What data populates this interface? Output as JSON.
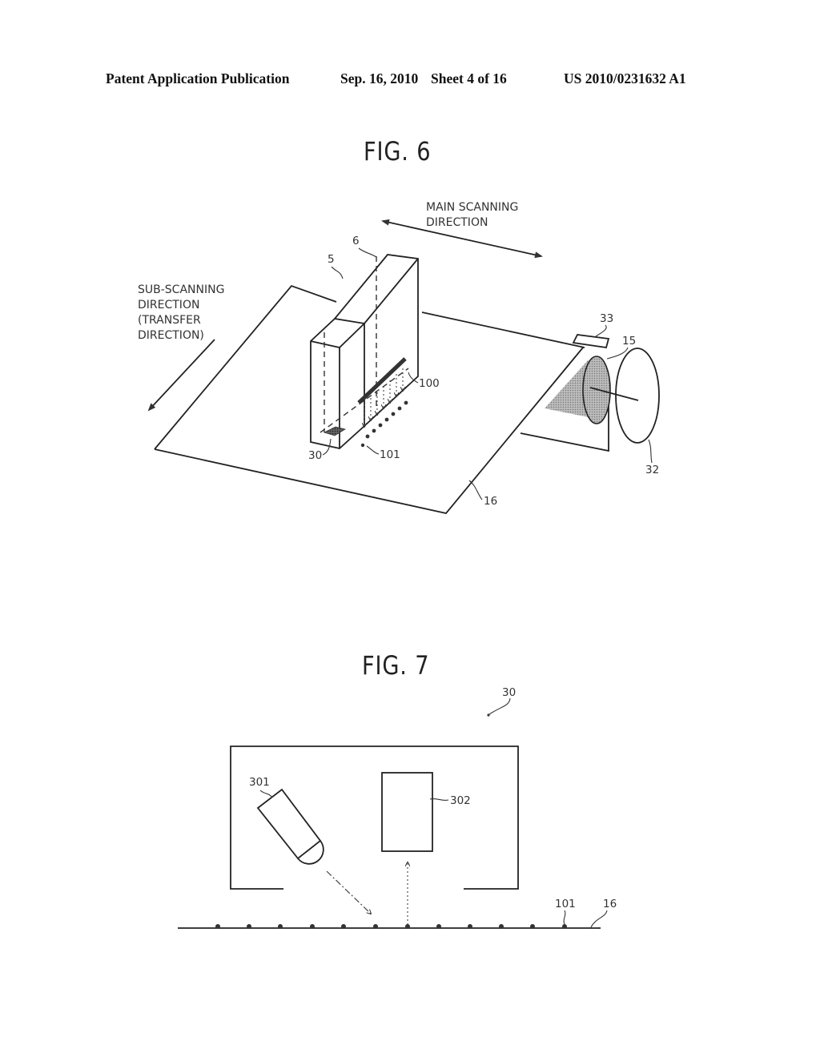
{
  "header": {
    "publication_type": "Patent Application Publication",
    "date": "Sep. 16, 2010",
    "sheet": "Sheet 4 of 16",
    "publication_number": "US 2010/0231632 A1"
  },
  "fig6": {
    "title": "FIG. 6",
    "main_scanning_label_line1": "MAIN SCANNING",
    "main_scanning_label_line2": "DIRECTION",
    "sub_scanning_label_line1": "SUB-SCANNING",
    "sub_scanning_label_line2": "DIRECTION",
    "sub_scanning_label_line3": "(TRANSFER",
    "sub_scanning_label_line4": "DIRECTION)",
    "refs": {
      "r5": "5",
      "r6": "6",
      "r100": "100",
      "r30": "30",
      "r101": "101",
      "r16": "16",
      "r33": "33",
      "r15": "15",
      "r32": "32"
    }
  },
  "fig7": {
    "title": "FIG. 7",
    "refs": {
      "r30": "30",
      "r301": "301",
      "r302": "302",
      "r101": "101",
      "r16": "16"
    }
  }
}
